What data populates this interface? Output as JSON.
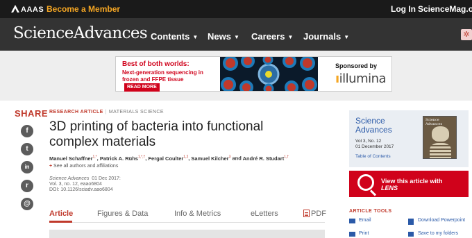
{
  "topbar": {
    "brand": "AAAS",
    "member_link": "Become a Member",
    "login_link": "Log In",
    "sciencemag_link": "ScienceMag.org"
  },
  "nav": {
    "logo": "ScienceAdvances",
    "items": [
      "Contents",
      "News",
      "Careers",
      "Journals"
    ]
  },
  "ad": {
    "headline": "Best of both worlds:",
    "sub1": "Next-generation sequencing in",
    "sub2": "frozen and FFPE tissue",
    "read_more": "READ MORE",
    "sponsored_by": "Sponsored by",
    "sponsor_name": "illumina"
  },
  "share": {
    "label": "SHARE",
    "buttons": [
      "f",
      "t",
      "in",
      "r",
      "@"
    ]
  },
  "article": {
    "type": "RESEARCH ARTICLE",
    "section": "MATERIALS SCIENCE",
    "title": "3D printing of bacteria into functional complex materials",
    "authors": [
      {
        "name": "Manuel Schaffner",
        "sup": "1,*",
        "sep": ", "
      },
      {
        "name": "Patrick A. Rühs",
        "sup": "1,*,†",
        "sep": ", "
      },
      {
        "name": "Fergal Coulter",
        "sup": "1,2",
        "sep": ", "
      },
      {
        "name": "Samuel Kilcher",
        "sup": "3",
        "sep": " and "
      },
      {
        "name": "André R. Studart",
        "sup": "1,†",
        "sep": ""
      }
    ],
    "see_all": "See all authors and affiliations",
    "journal": "Science Advances",
    "date": "01 Dec 2017:",
    "volume": "Vol. 3, no. 12, eaao6804",
    "doi": "DOI: 10.1126/sciadv.aao6804"
  },
  "tabs": [
    {
      "label": "Article",
      "active": true
    },
    {
      "label": "Figures & Data",
      "active": false
    },
    {
      "label": "Info & Metrics",
      "active": false
    },
    {
      "label": "eLetters",
      "active": false
    },
    {
      "label": "PDF",
      "active": false
    }
  ],
  "sidebar": {
    "journal_title_line1": "Science",
    "journal_title_line2": "Advances",
    "vol": "Vol 3, No. 12",
    "date": "01 December 2017",
    "toc": "Table of Contents",
    "cover_title": "Science Advances",
    "lens_line1": "View this article with",
    "lens_line2": "LENS",
    "tools_label": "ARTICLE TOOLS",
    "tools": [
      "Email",
      "Download Powerpoint",
      "Print",
      "Save to my folders"
    ]
  },
  "colors": {
    "accent_red": "#c0392b",
    "link_blue": "#2b5aa8",
    "member_orange": "#f5a623",
    "dark_bar": "#1a1a1a",
    "nav_bar": "#333333"
  }
}
